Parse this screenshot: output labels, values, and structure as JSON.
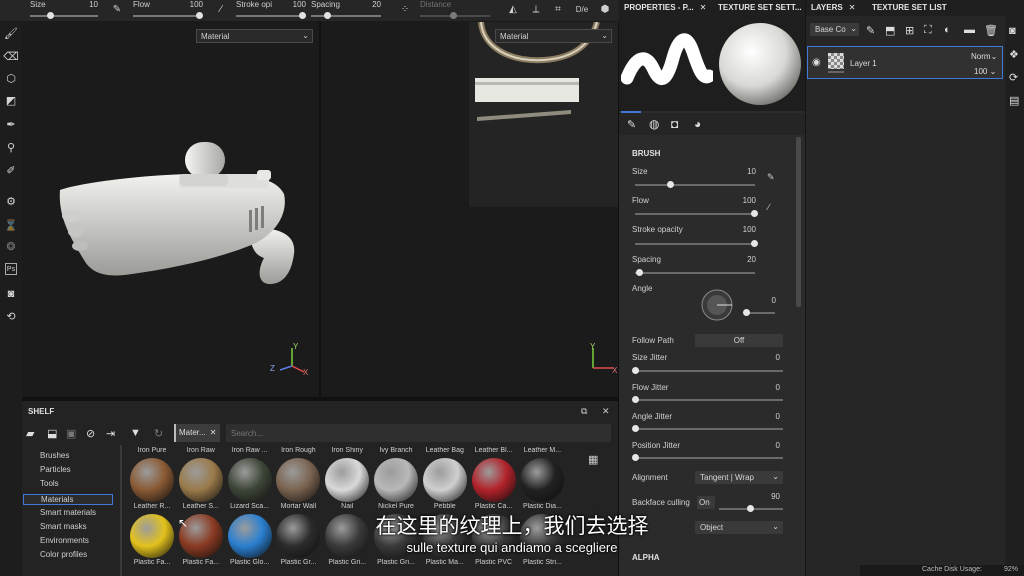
{
  "toolbar": {
    "size_label": "Size",
    "size_value": "10",
    "flow_label": "Flow",
    "flow_value": "100",
    "stroke_label": "Stroke opi",
    "stroke_value": "100",
    "spacing_label": "Spacing",
    "spacing_value": "20",
    "distance_label": "Distance",
    "mode_label": "D/e"
  },
  "viewport3d": {
    "material_dropdown": "Material"
  },
  "viewport2d": {
    "material_dropdown": "Material"
  },
  "axes": {
    "x": "X",
    "y": "Y",
    "z": "Z"
  },
  "properties": {
    "tab1": "PROPERTIES - P...",
    "tab2": "TEXTURE SET SETT...",
    "brush_section": "BRUSH",
    "size_label": "Size",
    "size_value": "10",
    "flow_label": "Flow",
    "flow_value": "100",
    "stroke_label": "Stroke opacity",
    "stroke_value": "100",
    "spacing_label": "Spacing",
    "spacing_value": "20",
    "angle_label": "Angle",
    "angle_value": "0",
    "follow_path_label": "Follow Path",
    "follow_path_value": "Off",
    "size_jitter_label": "Size Jitter",
    "size_jitter_value": "0",
    "flow_jitter_label": "Flow Jitter",
    "flow_jitter_value": "0",
    "angle_jitter_label": "Angle Jitter",
    "angle_jitter_value": "0",
    "position_jitter_label": "Position Jitter",
    "position_jitter_value": "0",
    "alignment_label": "Alignment",
    "alignment_value": "Tangent | Wrap",
    "backface_label": "Backface culling",
    "backface_value": "On",
    "backface_num": "90",
    "object_value": "Object",
    "alpha_section": "ALPHA"
  },
  "layers": {
    "tab1": "LAYERS",
    "tab2": "TEXTURE SET LIST",
    "channel_dropdown": "Base Co",
    "layer_name": "Layer 1",
    "blend_mode": "Norm",
    "opacity": "100"
  },
  "shelf": {
    "title": "SHELF",
    "filter_tag": "Mater...",
    "search_placeholder": "Search...",
    "categories": [
      "Brushes",
      "Particles",
      "Tools",
      "Materials",
      "Smart materials",
      "Smart masks",
      "Environments",
      "Color profiles"
    ],
    "top_labels": [
      "Iron Pure",
      "Iron Raw",
      "Iron Raw ...",
      "Iron Rough",
      "Iron Shiny",
      "Ivy Branch",
      "Leather Bag",
      "Leather Bl...",
      "Leather M..."
    ],
    "row1": [
      "Leather R...",
      "Leather S...",
      "Lizard Sca...",
      "Mortar Wall",
      "Nail",
      "Nickel Pure",
      "Pebble",
      "Plastic Ca...",
      "Plastic Dia..."
    ],
    "row2": [
      "Plastic Fa...",
      "Plastic Fa...",
      "Plastic Glo...",
      "Plastic Gr...",
      "Plastic Gri...",
      "Plastic Gri...",
      "Plastic Ma...",
      "Plastic PVC",
      "Plastic Stri..."
    ]
  },
  "subtitles": {
    "chinese": "在这里的纹理上，我们去选择",
    "italian": "sulle texture qui andiamo a scegliere"
  },
  "status": {
    "label": "Cache Disk Usage:",
    "value": "92%"
  }
}
